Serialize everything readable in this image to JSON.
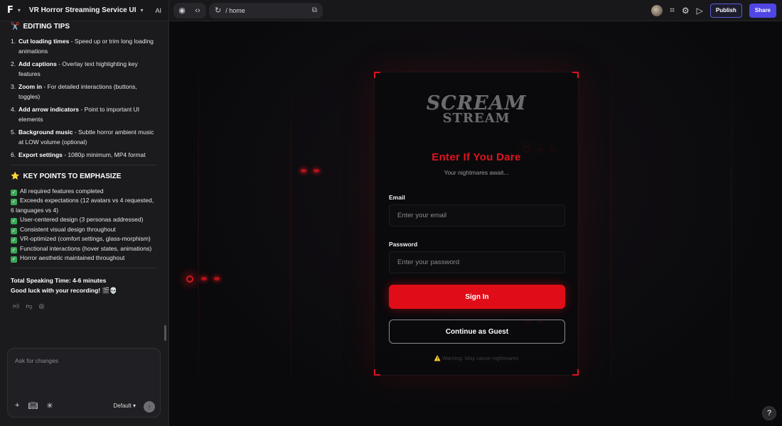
{
  "topbar": {
    "logo_glyph": "F",
    "project_title": "VR Horror Streaming Service UI",
    "ai_label": "AI",
    "url_path": "/ home",
    "publish_label": "Publish",
    "share_label": "Share"
  },
  "sidebar": {
    "editing": {
      "emoji": "✂️",
      "title": "EDITING TIPS",
      "items": [
        {
          "num": "1.",
          "bold": "Cut loading times",
          "rest": " - Speed up or trim long loading animations"
        },
        {
          "num": "2.",
          "bold": "Add captions",
          "rest": " - Overlay text highlighting key features"
        },
        {
          "num": "3.",
          "bold": "Zoom in",
          "rest": " - For detailed interactions (buttons, toggles)"
        },
        {
          "num": "4.",
          "bold": "Add arrow indicators",
          "rest": " - Point to important UI elements"
        },
        {
          "num": "5.",
          "bold": "Background music",
          "rest": " - Subtle horror ambient music at LOW volume (optional)"
        },
        {
          "num": "6.",
          "bold": "Export settings",
          "rest": " - 1080p minimum, MP4 format"
        }
      ]
    },
    "key_points": {
      "emoji": "⭐",
      "title": "KEY POINTS TO EMPHASIZE",
      "items": [
        "All required features completed",
        "Exceeds expectations (12 avatars vs 4 requested, 6 languages vs 4)",
        "User-centered design (3 personas addressed)",
        "Consistent visual design throughout",
        "VR-optimized (comfort settings, glass-morphism)",
        "Functional interactions (hover states, animations)",
        "Horror aesthetic maintained throughout"
      ]
    },
    "speaking_time": "Total Speaking Time: 4-6 minutes",
    "good_luck": "Good luck with your recording! 🎬💀",
    "chat": {
      "placeholder": "Ask for changes",
      "model_label": "Default"
    }
  },
  "login": {
    "brand_line1": "SCREAM",
    "brand_line2": "STREAM",
    "headline": "Enter If You Dare",
    "subline": "Your nightmares await...",
    "email_label": "Email",
    "email_placeholder": "Enter your email",
    "password_label": "Password",
    "password_placeholder": "Enter your password",
    "signin_label": "Sign In",
    "guest_label": "Continue as Guest",
    "warning": "⚠️ Warning: May cause nightmares"
  },
  "colors": {
    "accent_red": "#e00d18",
    "publish_border": "#5b5bd6",
    "share_bg": "#4f46e5"
  }
}
